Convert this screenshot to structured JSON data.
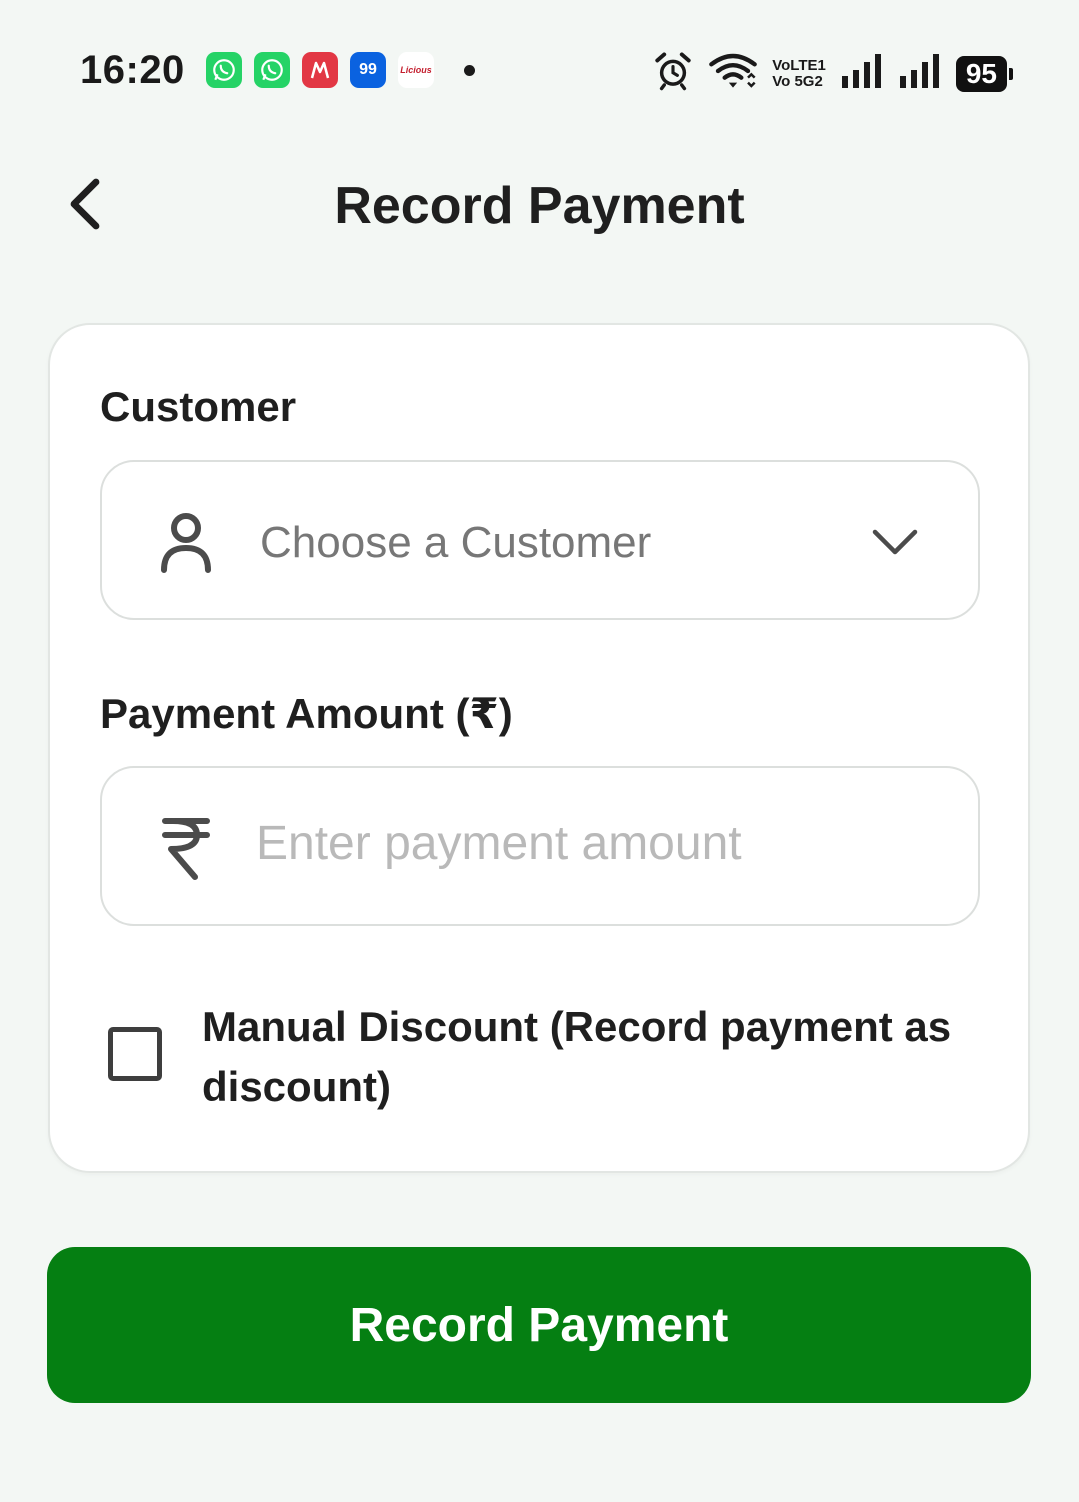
{
  "status_bar": {
    "time": "16:20",
    "notification_icons": [
      "whatsapp-icon",
      "whatsapp-business-icon",
      "myntra-icon",
      "99acres-icon",
      "licious-icon"
    ],
    "app_labels": {
      "ninety_nine": "99",
      "licious": "Licious"
    },
    "volte_line1": "VoLTE1",
    "volte_line2": "Vo 5G2",
    "battery": "95"
  },
  "header": {
    "title": "Record Payment",
    "back_icon": "chevron-left-icon"
  },
  "form": {
    "customer_label": "Customer",
    "customer_placeholder": "Choose a Customer",
    "customer_icon": "person-icon",
    "amount_label": "Payment Amount (₹)",
    "amount_placeholder": "Enter payment amount",
    "amount_icon": "rupee-icon",
    "amount_value": "",
    "discount_label": "Manual Discount (Record payment as discount)",
    "discount_checked": false
  },
  "submit_label": "Record Payment",
  "colors": {
    "background": "#f3f7f4",
    "primary": "#057f12",
    "whatsapp": "#25d366",
    "myntra": "#e23744",
    "acres": "#0a62e0"
  }
}
